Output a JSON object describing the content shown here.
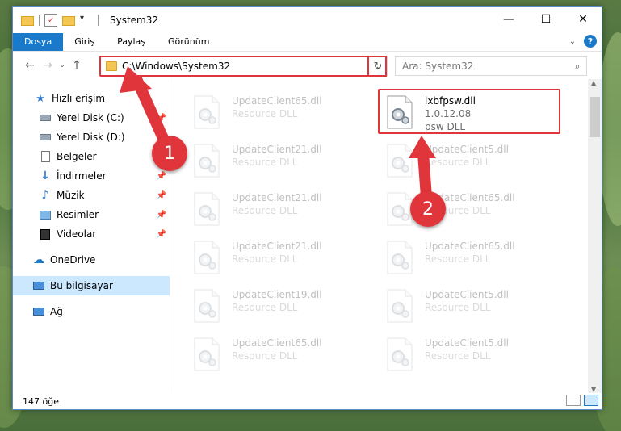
{
  "window": {
    "title": "System32",
    "controls": {
      "minimize": "—",
      "maximize": "☐",
      "close": "✕"
    }
  },
  "ribbon": {
    "tabs": [
      {
        "label": "Dosya",
        "active": true
      },
      {
        "label": "Giriş",
        "active": false
      },
      {
        "label": "Paylaş",
        "active": false
      },
      {
        "label": "Görünüm",
        "active": false
      }
    ],
    "help": "?"
  },
  "nav": {
    "address": "C:\\Windows\\System32",
    "search_placeholder": "Ara: System32"
  },
  "sidebar": {
    "items": [
      {
        "label": "Hızlı erişim",
        "icon": "star-icon",
        "pinned": false,
        "indent": 1,
        "selected": false
      },
      {
        "label": "Yerel Disk (C:)",
        "icon": "drive-icon",
        "pinned": true,
        "indent": 2,
        "selected": false
      },
      {
        "label": "Yerel Disk (D:)",
        "icon": "drive-icon",
        "pinned": false,
        "indent": 2,
        "selected": false
      },
      {
        "label": "Belgeler",
        "icon": "documents-icon",
        "pinned": false,
        "indent": 2,
        "selected": false
      },
      {
        "label": "İndirmeler",
        "icon": "downloads-icon",
        "pinned": true,
        "indent": 2,
        "selected": false
      },
      {
        "label": "Müzik",
        "icon": "music-icon",
        "pinned": true,
        "indent": 2,
        "selected": false
      },
      {
        "label": "Resimler",
        "icon": "pictures-icon",
        "pinned": true,
        "indent": 2,
        "selected": false
      },
      {
        "label": "Videolar",
        "icon": "videos-icon",
        "pinned": true,
        "indent": 2,
        "selected": false
      },
      {
        "label": "OneDrive",
        "icon": "cloud-icon",
        "pinned": false,
        "indent": 1,
        "selected": false
      },
      {
        "label": "Bu bilgisayar",
        "icon": "computer-icon",
        "pinned": false,
        "indent": 1,
        "selected": true
      },
      {
        "label": "Ağ",
        "icon": "network-icon",
        "pinned": false,
        "indent": 1,
        "selected": false
      }
    ]
  },
  "files": {
    "left_column": [
      {
        "name": "UpdateClient65.dll",
        "type": "Resource DLL"
      },
      {
        "name": "UpdateClient21.dll",
        "type": "Resource DLL"
      },
      {
        "name": "UpdateClient21.dll",
        "type": "Resource DLL"
      },
      {
        "name": "UpdateClient21.dll",
        "type": "Resource DLL"
      },
      {
        "name": "UpdateClient19.dll",
        "type": "Resource DLL"
      },
      {
        "name": "UpdateClient65.dll",
        "type": "Resource DLL"
      }
    ],
    "right_column": [
      {
        "name": "lxbfpsw.dll",
        "type": "1.0.12.08",
        "sub2": "psw DLL",
        "highlighted": true
      },
      {
        "name": "UpdateClient5.dll",
        "type": "Resource DLL"
      },
      {
        "name": "UpdateClient65.dll",
        "type": "Resource DLL"
      },
      {
        "name": "UpdateClient65.dll",
        "type": "Resource DLL"
      },
      {
        "name": "UpdateClient5.dll",
        "type": "Resource DLL"
      },
      {
        "name": "UpdateClient5.dll",
        "type": "Resource DLL"
      }
    ]
  },
  "status": {
    "count": "147 öğe"
  },
  "callouts": {
    "one": "1",
    "two": "2"
  },
  "colors": {
    "accent": "#1979ca",
    "highlight": "#e0353b"
  }
}
